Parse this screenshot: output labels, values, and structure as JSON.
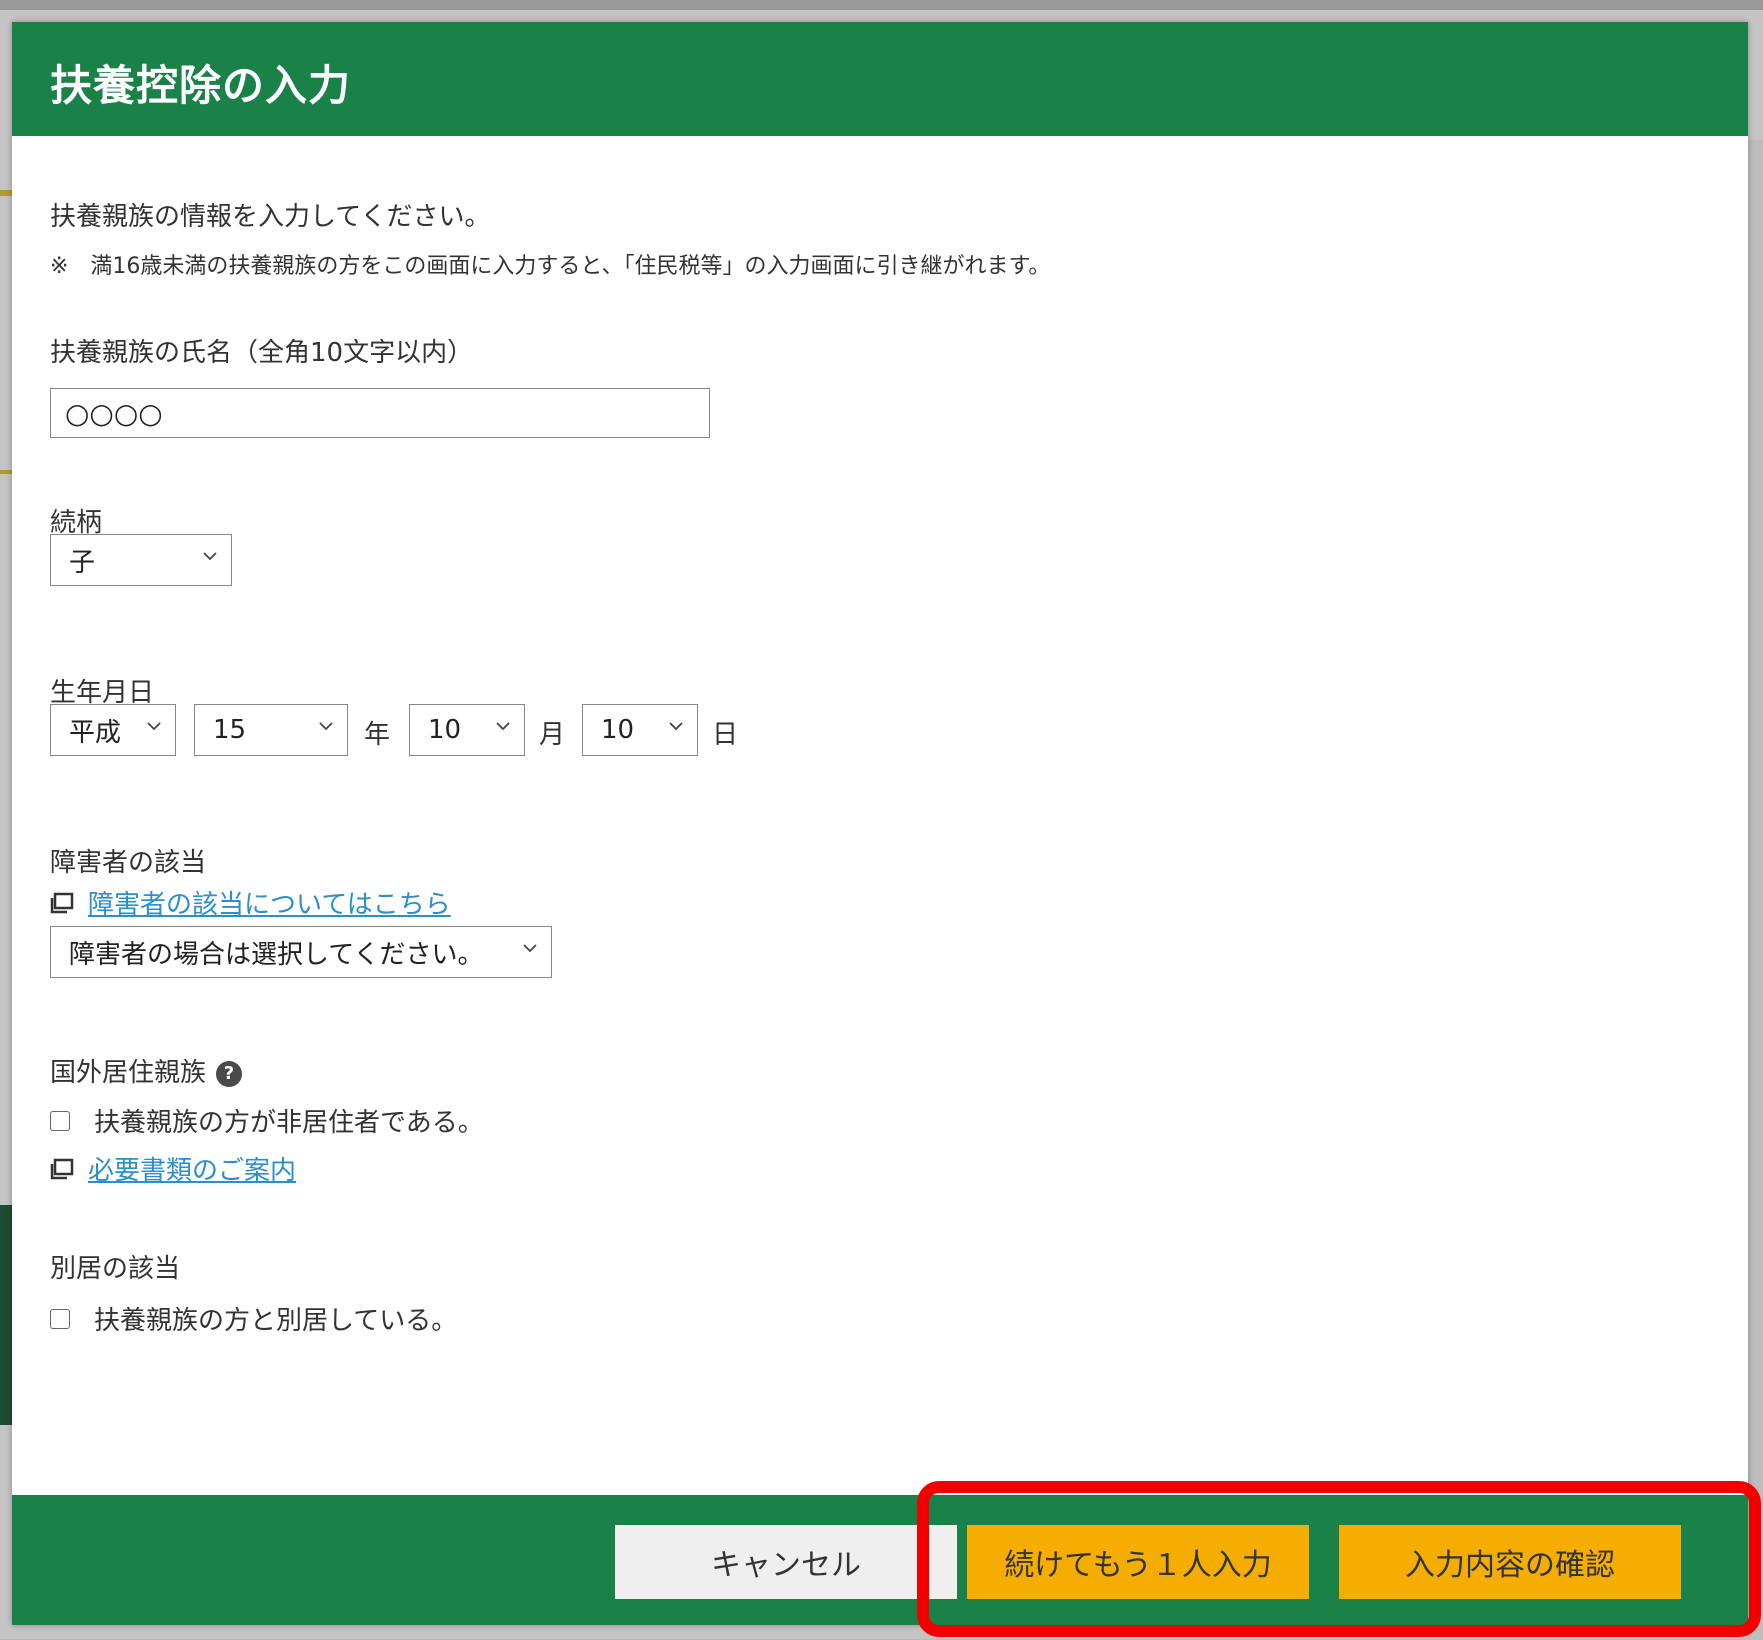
{
  "modal": {
    "title": "扶養控除の入力",
    "intro": "扶養親族の情報を入力してください。",
    "note": "※　満16歳未満の扶養親族の方をこの画面に入力すると、「住民税等」の入力画面に引き継がれます。"
  },
  "name_field": {
    "label": "扶養親族の氏名（全角10文字以内）",
    "value": "○○○○"
  },
  "relationship": {
    "label": "続柄",
    "selected": "子"
  },
  "birthdate": {
    "label": "生年月日",
    "era": "平成",
    "year": "15",
    "year_unit": "年",
    "month": "10",
    "month_unit": "月",
    "day": "10",
    "day_unit": "日"
  },
  "disability": {
    "label": "障害者の該当",
    "link_text": "障害者の該当についてはこちら",
    "selected": "障害者の場合は選択してください。"
  },
  "overseas": {
    "label": "国外居住親族",
    "help_glyph": "?",
    "checkbox_label": "扶養親族の方が非居住者である。",
    "link_text": "必要書類のご案内"
  },
  "separate": {
    "label": "別居の該当",
    "checkbox_label": "扶養親族の方と別居している。"
  },
  "footer": {
    "cancel_label": "キャンセル",
    "add_more_label": "続けてもう１人入力",
    "confirm_label": "入力内容の確認"
  },
  "colors": {
    "header_green": "#1a8149",
    "button_orange": "#f4ad00",
    "highlight_red": "#f20000",
    "link_blue": "#2b8fcc"
  }
}
